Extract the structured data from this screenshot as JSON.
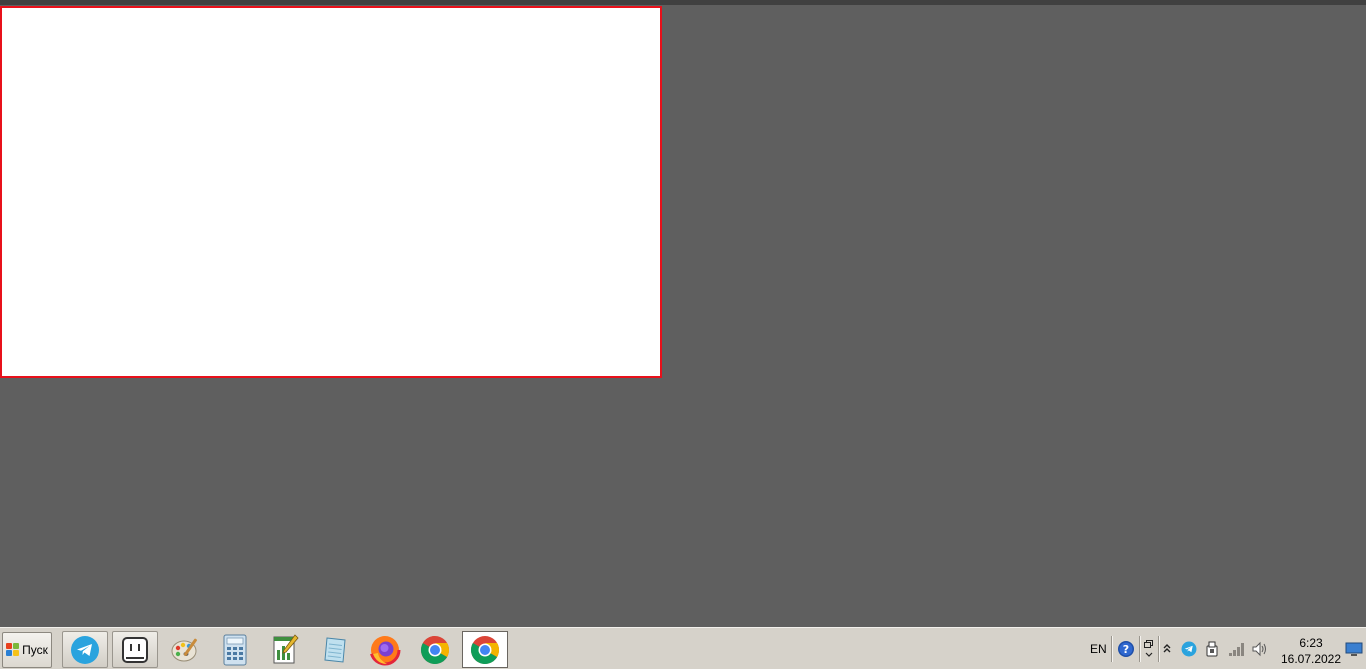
{
  "taskbar": {
    "start_label": "Пуск",
    "apps": [
      {
        "name": "telegram",
        "icon": "telegram-icon",
        "state": "pinned"
      },
      {
        "name": "robot-app",
        "icon": "robot-face-icon",
        "state": "pinned"
      },
      {
        "name": "paint",
        "icon": "paint-palette-icon",
        "state": "normal"
      },
      {
        "name": "calculator",
        "icon": "calculator-icon",
        "state": "normal"
      },
      {
        "name": "sheet-editor",
        "icon": "chart-sheet-icon",
        "state": "normal"
      },
      {
        "name": "notepad",
        "icon": "notepad-icon",
        "state": "normal"
      },
      {
        "name": "firefox",
        "icon": "firefox-icon",
        "state": "normal"
      },
      {
        "name": "chrome",
        "icon": "chrome-icon",
        "state": "normal"
      },
      {
        "name": "chrome-active",
        "icon": "chrome-icon",
        "state": "active"
      }
    ],
    "tray": {
      "language": "EN",
      "time": "6:23",
      "date": "16.07.2022"
    }
  },
  "colors": {
    "desktop": "#5f5f5f",
    "window_border": "#e8101a",
    "taskbar": "#d6d2ca"
  }
}
